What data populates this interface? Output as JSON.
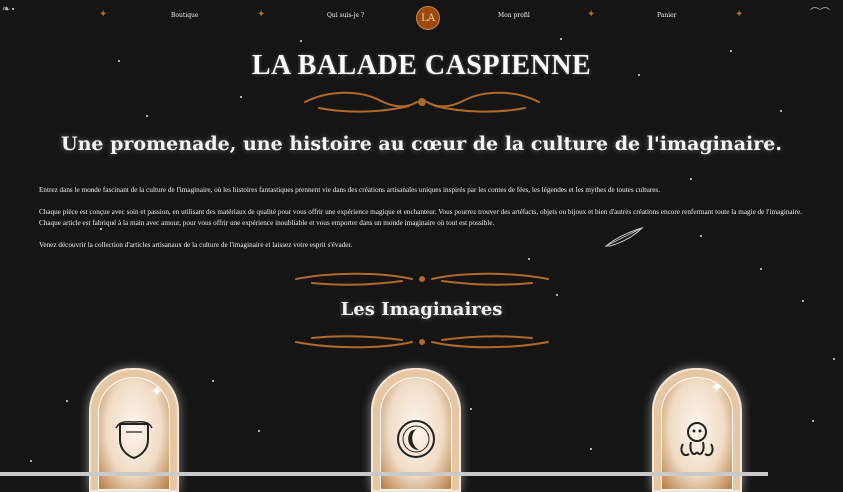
{
  "nav": {
    "links": [
      "Boutique",
      "Qui suis-je ?",
      "Mon profil",
      "Panier"
    ],
    "logo": "LA"
  },
  "hero": {
    "title": "LA BALADE CASPIENNE",
    "tagline": "Une promenade, une histoire au cœur de la culture de l'imaginaire."
  },
  "intro": {
    "p1": "Entrez dans le monde fascinant de la culture de l'imaginaire, où les histoires fantastiques prennent vie dans des créations artisanales uniques inspirés par les contes de fées, les légendes et les mythes de toutes cultures.",
    "p2": "Chaque pièce est conçue avec soin et passion, en utilisant des matériaux de qualité pour vous offrir une expérience magique et enchanteur. Vous pourrez trouver des artéfacts, objets ou bijoux et bien d'autres créations encore renfermant toute la magie de l'imaginaire. Chaque article est fabriqué à la main avec amour, pour vous offrir une expérience inoubliable et vous emporter dans un monde imaginaire où tout est possible.",
    "p3": "Venez découvrir la collection d'articles artisanaux de la culture de l'imaginaire et laissez votre esprit s'évader."
  },
  "section": {
    "title": "Les Imaginaires"
  },
  "cards": [
    {
      "icon": "shield-crest-icon"
    },
    {
      "icon": "moon-medallion-icon"
    },
    {
      "icon": "kraken-icon"
    }
  ],
  "colors": {
    "background": "#151515",
    "accent": "#b06a2a",
    "card": "#e7c6a3"
  }
}
